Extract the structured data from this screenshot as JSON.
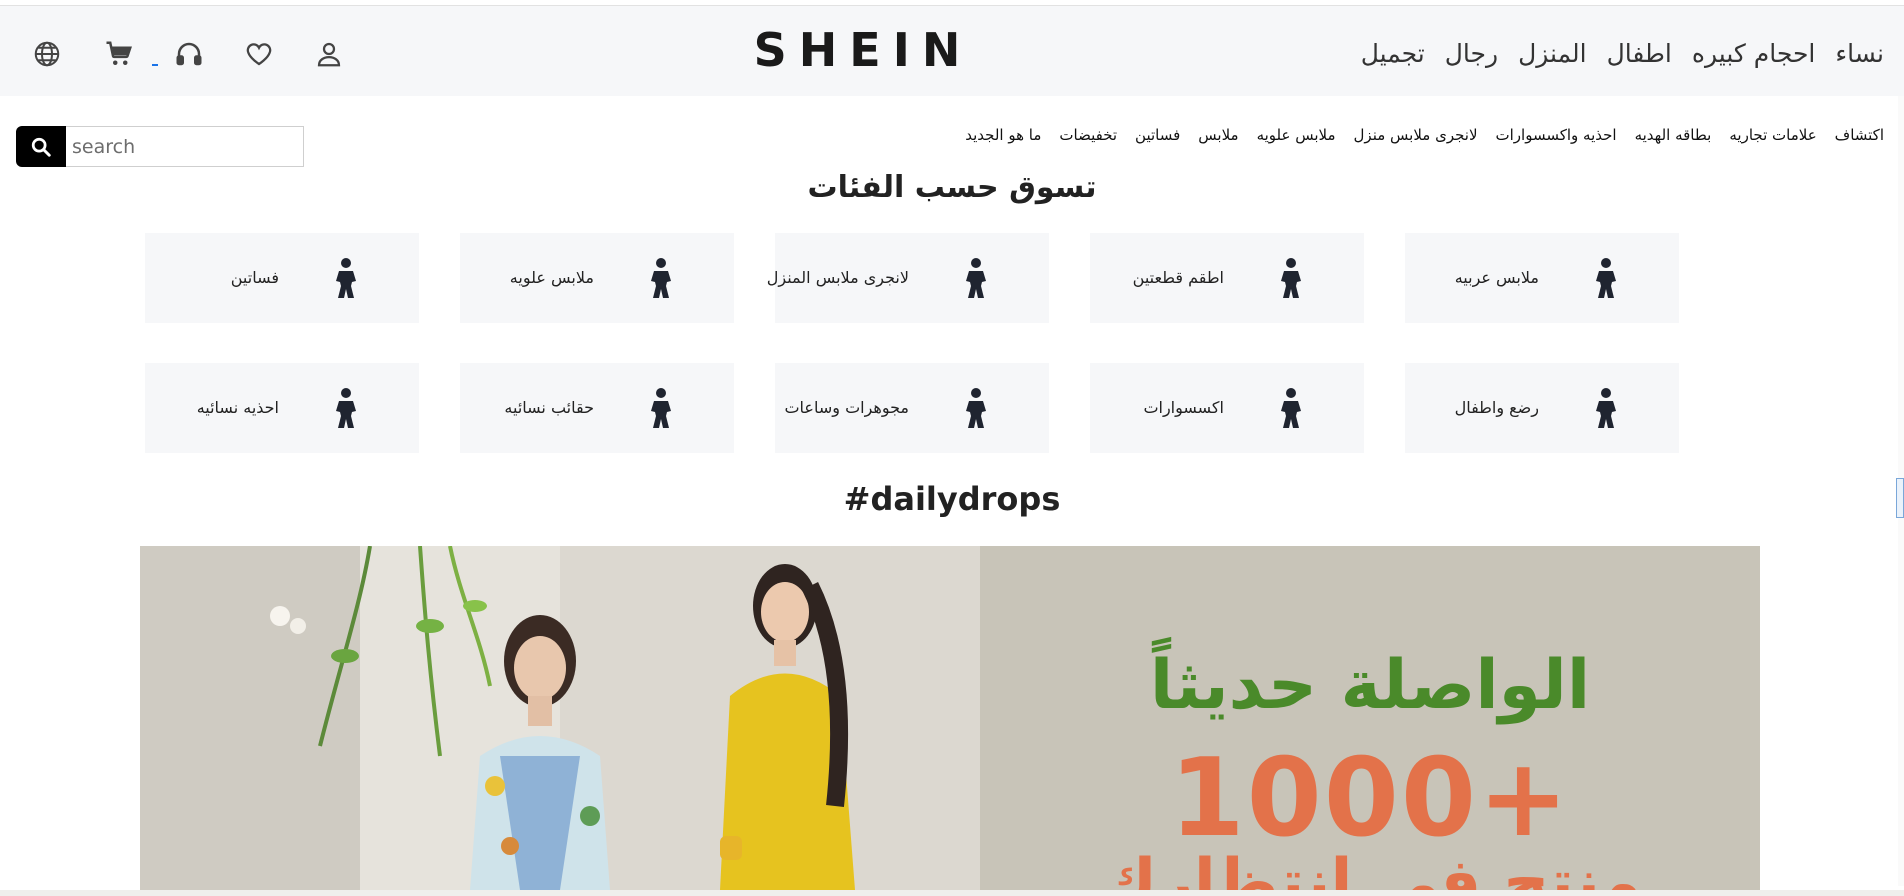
{
  "brand": {
    "logo": "SHEIN"
  },
  "header": {
    "icons": [
      "globe-icon",
      "cart-icon",
      "headset-icon",
      "heart-icon",
      "user-icon"
    ],
    "main_nav": [
      "نساء",
      "احجام كبيره",
      "اطفال",
      "المنزل",
      "رجال",
      "تجميل"
    ]
  },
  "sub_nav": [
    "اكتشاف",
    "علامات تجاريه",
    "بطاقه الهديه",
    "احذيه واكسسوارات",
    "لانجرى ملابس منزل",
    "ملابس علويه",
    "ملابس",
    "فساتين",
    "تخفيضات",
    "ما هو الجديد"
  ],
  "search": {
    "placeholder": "search",
    "value": ""
  },
  "categories_section": {
    "title": "تسوق حسب الفئات",
    "items": [
      {
        "label": "ملابس عربيه",
        "icon": "female-figure-icon"
      },
      {
        "label": "اطقم قطعتين",
        "icon": "female-figure-icon"
      },
      {
        "label": "لانجرى ملابس المنزل",
        "icon": "female-figure-icon"
      },
      {
        "label": "ملابس علويه",
        "icon": "female-figure-icon"
      },
      {
        "label": "فساتين",
        "icon": "female-figure-icon"
      },
      {
        "label": "رضع واطفال",
        "icon": "female-figure-icon"
      },
      {
        "label": "اكسسوارات",
        "icon": "female-figure-icon"
      },
      {
        "label": "مجوهرات وساعات",
        "icon": "female-figure-icon"
      },
      {
        "label": "حقائب نسائيه",
        "icon": "female-figure-icon"
      },
      {
        "label": "احذيه نسائيه",
        "icon": "female-figure-icon"
      }
    ]
  },
  "daily": {
    "title": "#dailydrops"
  },
  "banner": {
    "headline": "الواصلة حديثاً",
    "count": "1000+",
    "subline": "منتج في انتظارك"
  },
  "colors": {
    "header_bg": "#f6f7f9",
    "card_bg": "#f6f7f9",
    "search_button": "#000000",
    "banner_green": "#4a8a2a",
    "banner_orange": "#e3724a"
  }
}
